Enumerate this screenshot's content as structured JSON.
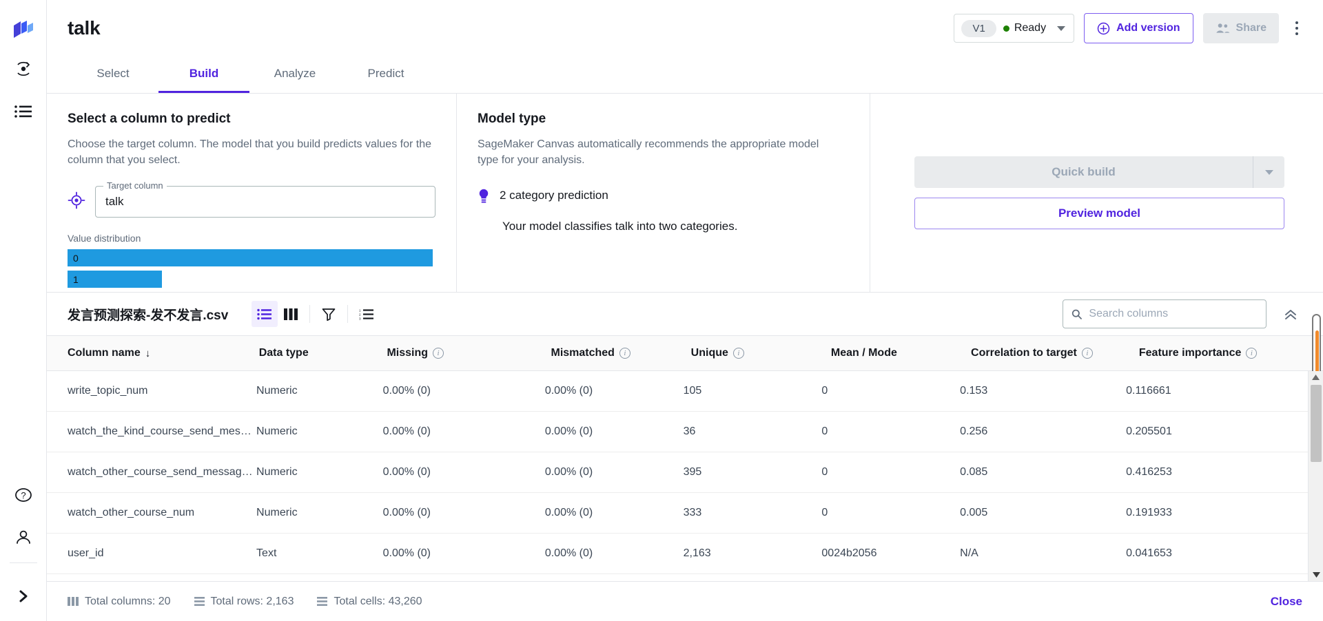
{
  "app": {
    "logo_icon": "canvas-logo-icon",
    "rail_items": [
      {
        "name": "data-flow-icon",
        "label": "Data flow"
      },
      {
        "name": "list-icon",
        "label": "Models list"
      }
    ],
    "rail_bottom": [
      {
        "name": "help-icon",
        "label": "Help"
      },
      {
        "name": "account-icon",
        "label": "Account"
      },
      {
        "name": "expand-rail-icon",
        "label": "Expand"
      }
    ]
  },
  "header": {
    "title": "talk",
    "version_chip": "V1",
    "status": "Ready",
    "status_color": "#1d8102",
    "add_version_label": "Add version",
    "share_label": "Share",
    "more_icon": "kebab-menu-icon",
    "accent_color": "#5023df"
  },
  "tabs": [
    {
      "label": "Select",
      "active": false
    },
    {
      "label": "Build",
      "active": true
    },
    {
      "label": "Analyze",
      "active": false
    },
    {
      "label": "Predict",
      "active": false
    }
  ],
  "target_panel": {
    "heading": "Select a column to predict",
    "description": "Choose the target column. The model that you build predicts values for the column that you select.",
    "field_legend": "Target column",
    "field_value": "talk",
    "distribution_label": "Value distribution",
    "bar_color": "#1f9ae0"
  },
  "model_type_panel": {
    "heading": "Model type",
    "description": "SageMaker Canvas automatically recommends the appropriate model type for your analysis.",
    "type_icon": "lightbulb-icon",
    "type_label": "2 category prediction",
    "type_description": "Your model classifies talk into two categories."
  },
  "actions_panel": {
    "quick_build_label": "Quick build",
    "quick_build_dropdown_icon": "chevron-down-icon",
    "preview_model_label": "Preview model"
  },
  "dataset_toolbar": {
    "file_name": "发言预测探索-发不发言.csv",
    "view_icons": [
      {
        "name": "list-view-icon",
        "selected": true
      },
      {
        "name": "grid-view-icon",
        "selected": false
      },
      {
        "name": "filter-icon",
        "selected": false
      },
      {
        "name": "sort-list-icon",
        "selected": false
      }
    ],
    "search_placeholder": "Search columns",
    "search_value": "",
    "search_icon": "search-icon",
    "collapse_icon": "chevron-double-up-icon"
  },
  "table": {
    "columns": [
      {
        "label": "Column name",
        "sorted": true,
        "sort_icon": "↓",
        "info": false
      },
      {
        "label": "Data type",
        "info": false
      },
      {
        "label": "Missing",
        "info": true
      },
      {
        "label": "Mismatched",
        "info": true
      },
      {
        "label": "Unique",
        "info": true
      },
      {
        "label": "Mean / Mode",
        "info": false
      },
      {
        "label": "Correlation to target",
        "info": true
      },
      {
        "label": "Feature importance",
        "info": true
      }
    ],
    "rows": [
      {
        "column_name": "write_topic_num",
        "data_type": "Numeric",
        "missing": "0.00% (0)",
        "mismatched": "0.00% (0)",
        "unique": "105",
        "mean_mode": "0",
        "correlation": "0.153",
        "feature_importance": "0.116661"
      },
      {
        "column_name": "watch_the_kind_course_send_messag...",
        "data_type": "Numeric",
        "missing": "0.00% (0)",
        "mismatched": "0.00% (0)",
        "unique": "36",
        "mean_mode": "0",
        "correlation": "0.256",
        "feature_importance": "0.205501"
      },
      {
        "column_name": "watch_other_course_send_message_...",
        "data_type": "Numeric",
        "missing": "0.00% (0)",
        "mismatched": "0.00% (0)",
        "unique": "395",
        "mean_mode": "0",
        "correlation": "0.085",
        "feature_importance": "0.416253"
      },
      {
        "column_name": "watch_other_course_num",
        "data_type": "Numeric",
        "missing": "0.00% (0)",
        "mismatched": "0.00% (0)",
        "unique": "333",
        "mean_mode": "0",
        "correlation": "0.005",
        "feature_importance": "0.191933"
      },
      {
        "column_name": "user_id",
        "data_type": "Text",
        "missing": "0.00% (0)",
        "mismatched": "0.00% (0)",
        "unique": "2,163",
        "mean_mode": "0024b2056",
        "correlation": "N/A",
        "feature_importance": "0.041653"
      }
    ]
  },
  "footer": {
    "total_columns": "Total columns: 20",
    "total_rows": "Total rows: 2,163",
    "total_cells": "Total cells: 43,260",
    "close_label": "Close"
  },
  "chart_data": {
    "type": "bar",
    "title": "Value distribution",
    "categories": [
      "0",
      "1"
    ],
    "values": [
      100,
      26
    ],
    "orientation": "horizontal",
    "xlabel": "",
    "ylabel": "",
    "xlim": [
      0,
      100
    ],
    "grid": false,
    "legend": "none",
    "bar_color": "#1f9ae0"
  }
}
